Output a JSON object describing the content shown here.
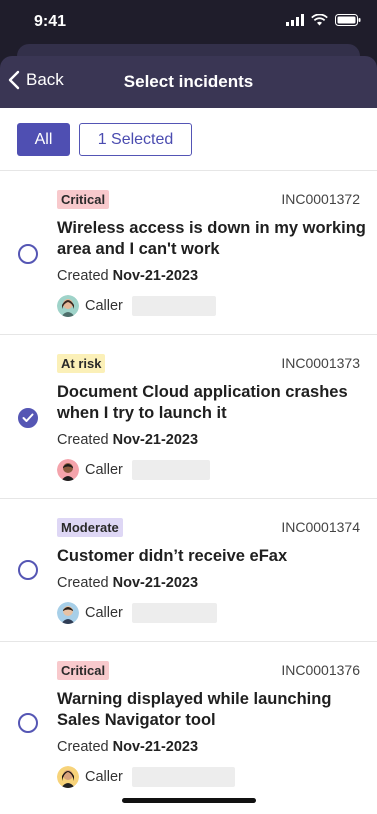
{
  "status": {
    "time": "9:41"
  },
  "nav": {
    "back_label": "Back",
    "title": "Select incidents"
  },
  "filters": {
    "all_label": "All",
    "selected_label": "1 Selected"
  },
  "incidents": [
    {
      "priority": "Critical",
      "number": "INC0001372",
      "title": "Wireless access is down in my working area and I can't work",
      "created_label": "Created",
      "created_date": "Nov-21-2023",
      "caller_label": "Caller",
      "selected": false
    },
    {
      "priority": "At risk",
      "number": "INC0001373",
      "title": "Document Cloud application crashes when I try to launch it",
      "created_label": "Created",
      "created_date": "Nov-21-2023",
      "caller_label": "Caller",
      "selected": true
    },
    {
      "priority": "Moderate",
      "number": "INC0001374",
      "title": "Customer didn’t receive eFax",
      "created_label": "Created",
      "created_date": "Nov-21-2023",
      "caller_label": "Caller",
      "selected": false
    },
    {
      "priority": "Critical",
      "number": "INC0001376",
      "title": "Warning displayed while launching Sales Navigator tool",
      "created_label": "Created",
      "created_date": "Nov-21-2023",
      "caller_label": "Caller",
      "selected": false
    }
  ],
  "colors": {
    "accent": "#4f4fb2",
    "header_bg": "#1f1d2b",
    "critical": "#f8c9cc",
    "at_risk": "#fbf0b8",
    "moderate": "#ded7f5"
  }
}
